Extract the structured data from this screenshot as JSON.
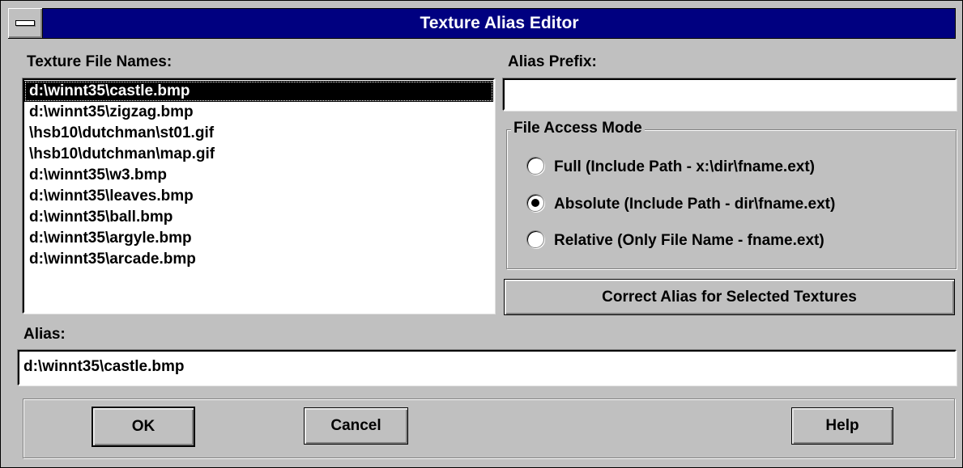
{
  "window": {
    "title": "Texture Alias Editor"
  },
  "labels": {
    "texture_file_names": "Texture File Names:",
    "alias_prefix": "Alias Prefix:",
    "file_access_mode": "File Access Mode",
    "alias": "Alias:"
  },
  "texture_list": {
    "items": [
      "d:\\winnt35\\castle.bmp",
      "d:\\winnt35\\zigzag.bmp",
      "\\hsb10\\dutchman\\st01.gif",
      "\\hsb10\\dutchman\\map.gif",
      "d:\\winnt35\\w3.bmp",
      "d:\\winnt35\\leaves.bmp",
      "d:\\winnt35\\ball.bmp",
      "d:\\winnt35\\argyle.bmp",
      "d:\\winnt35\\arcade.bmp"
    ],
    "selected_index": 0
  },
  "alias_prefix_value": "",
  "access_modes": [
    {
      "label": "Full (Include Path - x:\\dir\\fname.ext)",
      "selected": false
    },
    {
      "label": "Absolute (Include Path - dir\\fname.ext)",
      "selected": true
    },
    {
      "label": "Relative (Only File Name - fname.ext)",
      "selected": false
    }
  ],
  "correct_button_label": "Correct Alias for Selected Textures",
  "alias_value": "d:\\winnt35\\castle.bmp",
  "buttons": {
    "ok": "OK",
    "cancel": "Cancel",
    "help": "Help"
  }
}
